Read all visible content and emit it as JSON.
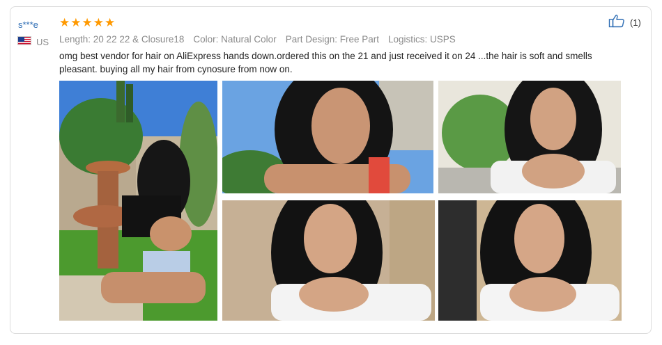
{
  "review": {
    "user_name": "s***e",
    "country_code": "US",
    "rating": 5,
    "stars": [
      "★",
      "★",
      "★",
      "★",
      "★"
    ],
    "attributes": [
      "Length: 20 22 22 & Closure18",
      "Color: Natural Color",
      "Part Design: Free Part",
      "Logistics: USPS"
    ],
    "text": "omg best vendor for hair on AliExpress hands down.ordered this on the 21 and just received it on 24 ...the hair is soft and smells pleasant. buying all my hair from cynosure from now on.",
    "helpful_count": "(1)"
  },
  "colors": {
    "star": "#ff9900",
    "user_name": "#2e6db4",
    "meta_text": "#8a8a8a",
    "border": "#dcdcdc",
    "thumb_icon": "#2e6db4"
  },
  "icons": {
    "thumbs_up": "thumbs-up-icon",
    "flag": "us-flag-icon"
  }
}
